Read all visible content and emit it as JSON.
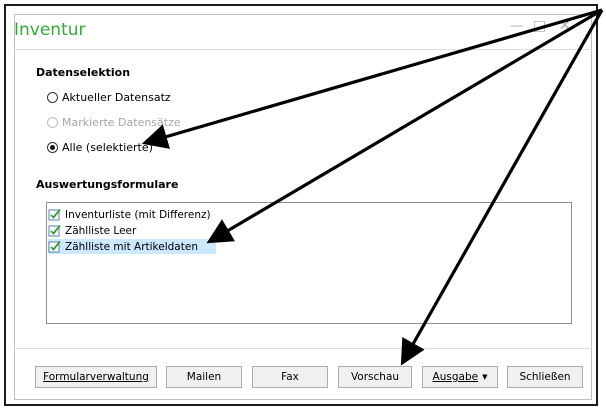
{
  "window": {
    "title": "Inventur",
    "controls": [
      "minimize-icon",
      "maximize-icon",
      "close-icon"
    ]
  },
  "data_selection": {
    "heading": "Datenselektion",
    "options": [
      {
        "label": "Aktueller Datensatz",
        "state": "enabled",
        "selected": false
      },
      {
        "label": "Markierte Datensätze",
        "state": "disabled",
        "selected": false
      },
      {
        "label": "Alle (selektierte)",
        "state": "enabled",
        "selected": true
      }
    ]
  },
  "forms": {
    "heading": "Auswertungsformulare",
    "items": [
      {
        "label": "Inventurliste (mit Differenz)",
        "icon": "form-checked-icon",
        "selected": false
      },
      {
        "label": "Zählliste Leer",
        "icon": "form-checked-icon",
        "selected": false
      },
      {
        "label": "Zählliste mit Artikeldaten",
        "icon": "form-checked-icon",
        "selected": true
      }
    ]
  },
  "buttons": {
    "form_manager": "Formularverwaltung",
    "mail": "Mailen",
    "fax": "Fax",
    "preview": "Vorschau",
    "output": "Ausgabe",
    "close": "Schließen"
  },
  "colors": {
    "title": "#3aa63a",
    "selection": "#cce8ff",
    "annotation_arrow": "#000000"
  }
}
